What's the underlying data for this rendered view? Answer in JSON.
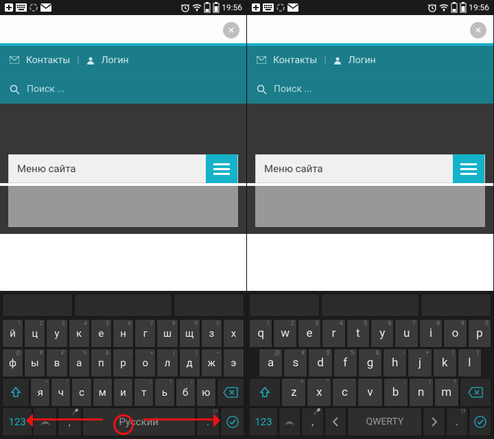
{
  "status": {
    "time": "19:56"
  },
  "header": {
    "contacts": "Контакты",
    "login": "Логин",
    "search_placeholder": "Поиск ..."
  },
  "menu": {
    "label": "Меню сайта"
  },
  "kb_ru": {
    "r1": [
      {
        "m": "й",
        "s": "1"
      },
      {
        "m": "ц",
        "s": "2"
      },
      {
        "m": "у",
        "s": "3"
      },
      {
        "m": "к",
        "s": "4"
      },
      {
        "m": "е",
        "s": "5"
      },
      {
        "m": "н",
        "s": "6"
      },
      {
        "m": "г",
        "s": "7"
      },
      {
        "m": "ш",
        "s": "8"
      },
      {
        "m": "щ",
        "s": "9"
      },
      {
        "m": "з",
        "s": "0"
      },
      {
        "m": "х",
        "s": ""
      }
    ],
    "r2": [
      {
        "m": "ф",
        "s": "@"
      },
      {
        "m": "ы",
        "s": "#"
      },
      {
        "m": "в",
        "s": "₽"
      },
      {
        "m": "а",
        "s": "%"
      },
      {
        "m": "п",
        "s": "&"
      },
      {
        "m": "р",
        "s": "-"
      },
      {
        "m": "о",
        "s": "+"
      },
      {
        "m": "л",
        "s": "("
      },
      {
        "m": "д",
        "s": ")"
      },
      {
        "m": "ж",
        "s": "="
      },
      {
        "m": "э",
        "s": ""
      }
    ],
    "r3": [
      {
        "m": "я",
        "s": "*"
      },
      {
        "m": "ч",
        "s": "\""
      },
      {
        "m": "с",
        "s": "'"
      },
      {
        "m": "м",
        "s": ":"
      },
      {
        "m": "и",
        "s": ";"
      },
      {
        "m": "т",
        "s": "!"
      },
      {
        "m": "ь",
        "s": "?"
      },
      {
        "m": "б",
        "s": "/"
      },
      {
        "m": "ю",
        "s": ""
      }
    ],
    "space": "Русский",
    "n123": "123",
    "comma": ",",
    "dot": "."
  },
  "kb_en": {
    "r1": [
      {
        "m": "q",
        "s": "1"
      },
      {
        "m": "w",
        "s": "2"
      },
      {
        "m": "e",
        "s": "3"
      },
      {
        "m": "r",
        "s": "4"
      },
      {
        "m": "t",
        "s": "5"
      },
      {
        "m": "y",
        "s": "6"
      },
      {
        "m": "u",
        "s": "7"
      },
      {
        "m": "i",
        "s": "8"
      },
      {
        "m": "o",
        "s": "9"
      },
      {
        "m": "p",
        "s": "0"
      }
    ],
    "r2": [
      {
        "m": "a",
        "s": "@"
      },
      {
        "m": "s",
        "s": "#"
      },
      {
        "m": "d",
        "s": "$"
      },
      {
        "m": "f",
        "s": "%"
      },
      {
        "m": "g",
        "s": "&"
      },
      {
        "m": "h",
        "s": "-"
      },
      {
        "m": "j",
        "s": "+"
      },
      {
        "m": "k",
        "s": "("
      },
      {
        "m": "l",
        "s": ")"
      }
    ],
    "r3": [
      {
        "m": "z",
        "s": "*"
      },
      {
        "m": "x",
        "s": "\""
      },
      {
        "m": "c",
        "s": "'"
      },
      {
        "m": "v",
        "s": ":"
      },
      {
        "m": "b",
        "s": ";"
      },
      {
        "m": "n",
        "s": "!"
      },
      {
        "m": "m",
        "s": "?"
      }
    ],
    "space": "QWERTY",
    "n123": "123",
    "comma": ",",
    "dot": "."
  }
}
